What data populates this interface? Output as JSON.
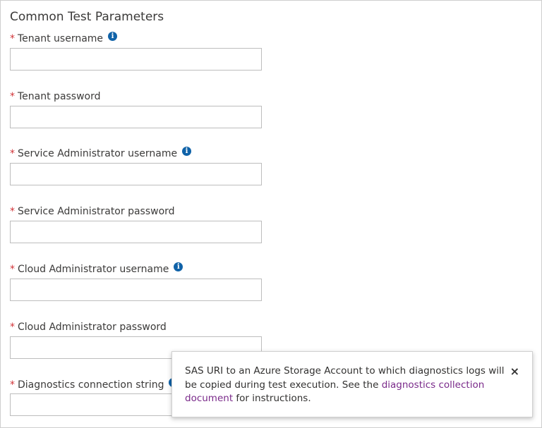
{
  "section": {
    "title": "Common Test Parameters"
  },
  "fields": [
    {
      "label": "Tenant username",
      "required_mark": "*",
      "has_info": true,
      "value": ""
    },
    {
      "label": "Tenant password",
      "required_mark": "*",
      "has_info": false,
      "value": ""
    },
    {
      "label": "Service Administrator username",
      "required_mark": "*",
      "has_info": true,
      "value": ""
    },
    {
      "label": "Service Administrator password",
      "required_mark": "*",
      "has_info": false,
      "value": ""
    },
    {
      "label": "Cloud Administrator username",
      "required_mark": "*",
      "has_info": true,
      "value": ""
    },
    {
      "label": "Cloud Administrator password",
      "required_mark": "*",
      "has_info": false,
      "value": ""
    },
    {
      "label": "Diagnostics connection string",
      "required_mark": "*",
      "has_info": true,
      "value": ""
    }
  ],
  "info_icon_glyph": "i",
  "tooltip": {
    "text_before": "SAS URI to an Azure Storage Account to which diagnostics logs will be copied during test execution. See the ",
    "link_text": "diagnostics collection document",
    "text_after": " for instructions.",
    "close_glyph": "×"
  },
  "colors": {
    "required": "#d13438",
    "info_icon": "#0f62a8",
    "link": "#7a2a8a",
    "border": "#bdbdbd"
  }
}
